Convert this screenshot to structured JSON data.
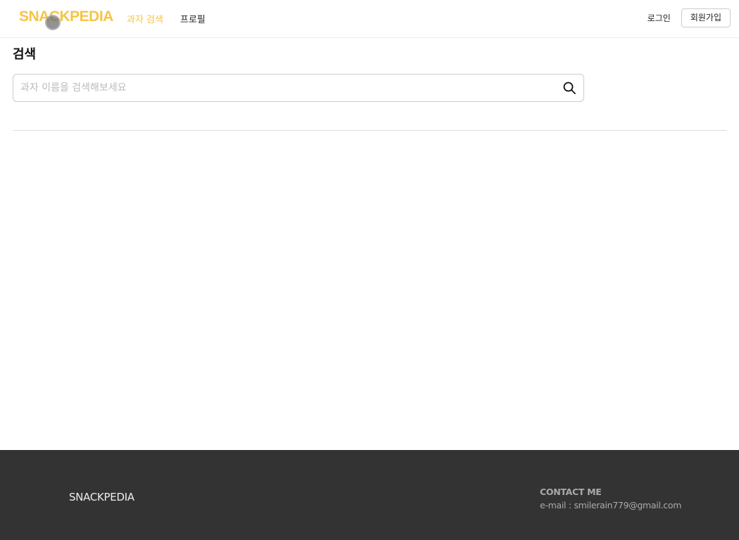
{
  "header": {
    "logo": "SNACKPEDIA",
    "nav": [
      {
        "label": "과자 검색",
        "active": true
      },
      {
        "label": "프로필",
        "active": false
      }
    ],
    "login_label": "로그인",
    "signup_label": "회원가입"
  },
  "main": {
    "title": "검색",
    "search": {
      "placeholder": "과자 이름을 검색해보세요",
      "value": "",
      "icon": "search-icon"
    }
  },
  "footer": {
    "logo": "SNACKPEDIA",
    "contact_title": "CONTACT ME",
    "contact_email": "e-mail : smilerain779@gmail.com"
  },
  "colors": {
    "accent": "#f6c445",
    "footer_bg": "#333333",
    "text": "#222222"
  }
}
